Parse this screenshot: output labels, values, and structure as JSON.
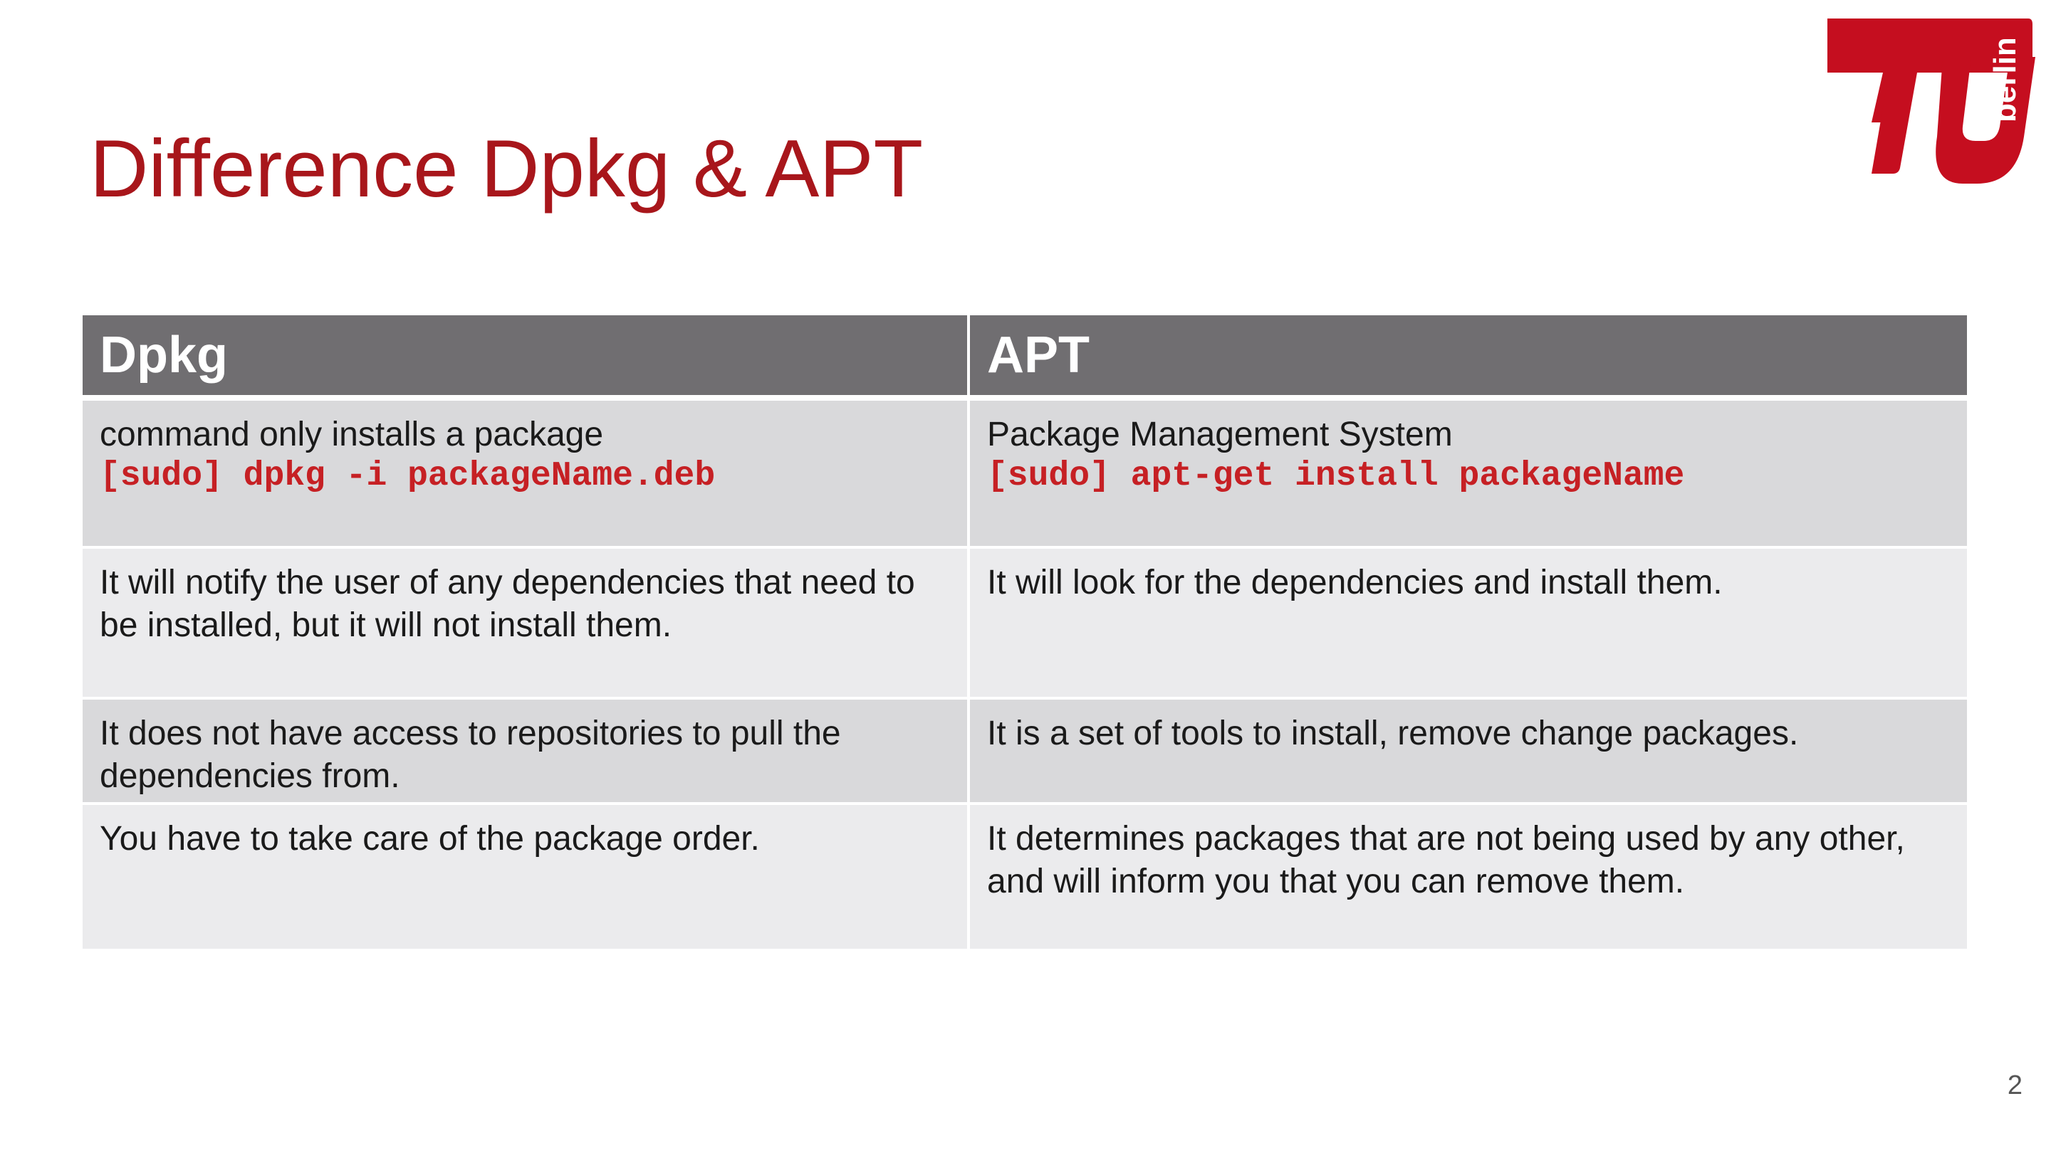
{
  "slide": {
    "title": "Difference Dpkg & APT",
    "page_number": "2"
  },
  "logo": {
    "icon": "tu-berlin-logo-icon",
    "text": "berlin",
    "color": "#c50e1f"
  },
  "colors": {
    "title": "#a8161b",
    "header_bg": "#706e71",
    "row_dark": "#d9d9db",
    "row_light": "#ebebed",
    "command": "#c62024"
  },
  "table": {
    "headers": [
      "Dpkg",
      "APT"
    ],
    "rows": [
      {
        "dpkg": {
          "text": "command only installs a package",
          "command": "[sudo] dpkg -i packageName.deb"
        },
        "apt": {
          "text": "Package Management System",
          "command": "[sudo] apt-get install packageName"
        }
      },
      {
        "dpkg": {
          "text": "It will notify the user of any dependencies that need to be installed, but it will not install them."
        },
        "apt": {
          "text": "It will look for the dependencies and install them."
        }
      },
      {
        "dpkg": {
          "text": "It does not have access to repositories to pull the dependencies from."
        },
        "apt": {
          "text": "It is a set of tools to install, remove change packages."
        }
      },
      {
        "dpkg": {
          "text": "You have to take care of the package order."
        },
        "apt": {
          "text": "It determines packages that are not being used by any other, and will inform you that you can remove them."
        }
      }
    ]
  }
}
